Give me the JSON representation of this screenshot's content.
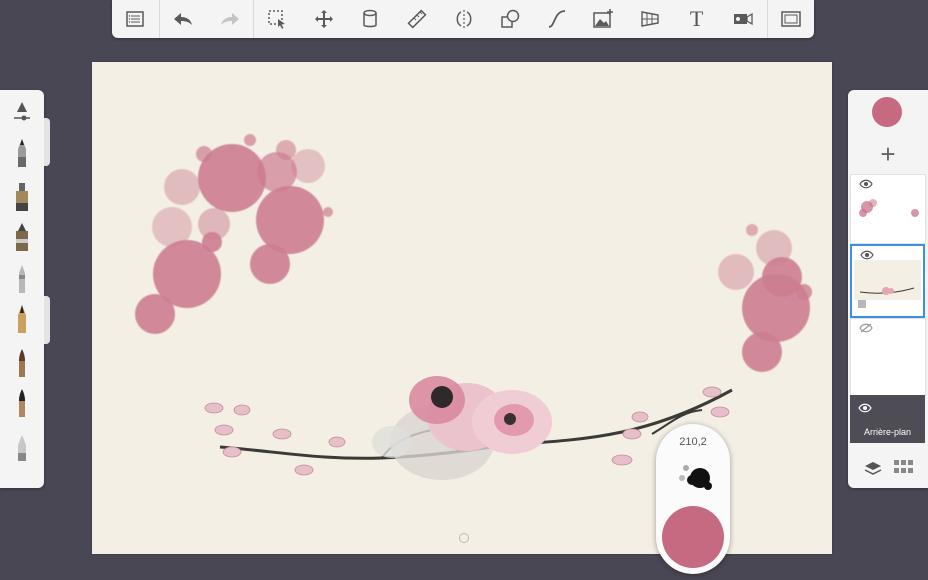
{
  "toolbar": {
    "items": [
      {
        "name": "menu-icon"
      },
      {
        "name": "undo-icon"
      },
      {
        "name": "redo-icon"
      },
      {
        "name": "selection-icon"
      },
      {
        "name": "transform-icon"
      },
      {
        "name": "fill-icon"
      },
      {
        "name": "ruler-icon"
      },
      {
        "name": "symmetry-icon"
      },
      {
        "name": "shapes-icon"
      },
      {
        "name": "curve-icon"
      },
      {
        "name": "image-import-icon"
      },
      {
        "name": "perspective-icon"
      },
      {
        "name": "text-icon",
        "glyph": "T"
      },
      {
        "name": "video-icon"
      },
      {
        "name": "fullscreen-icon"
      }
    ]
  },
  "brush_puck": {
    "size": "210,2",
    "color": "#c66a82"
  },
  "layers": {
    "current_color": "#c66a82",
    "background_label": "Arrière-plan"
  },
  "colors": {
    "paint": "#c66a82",
    "selection": "#3d8fe4",
    "canvas": "#f3efe4",
    "workspace": "#4a4754"
  }
}
